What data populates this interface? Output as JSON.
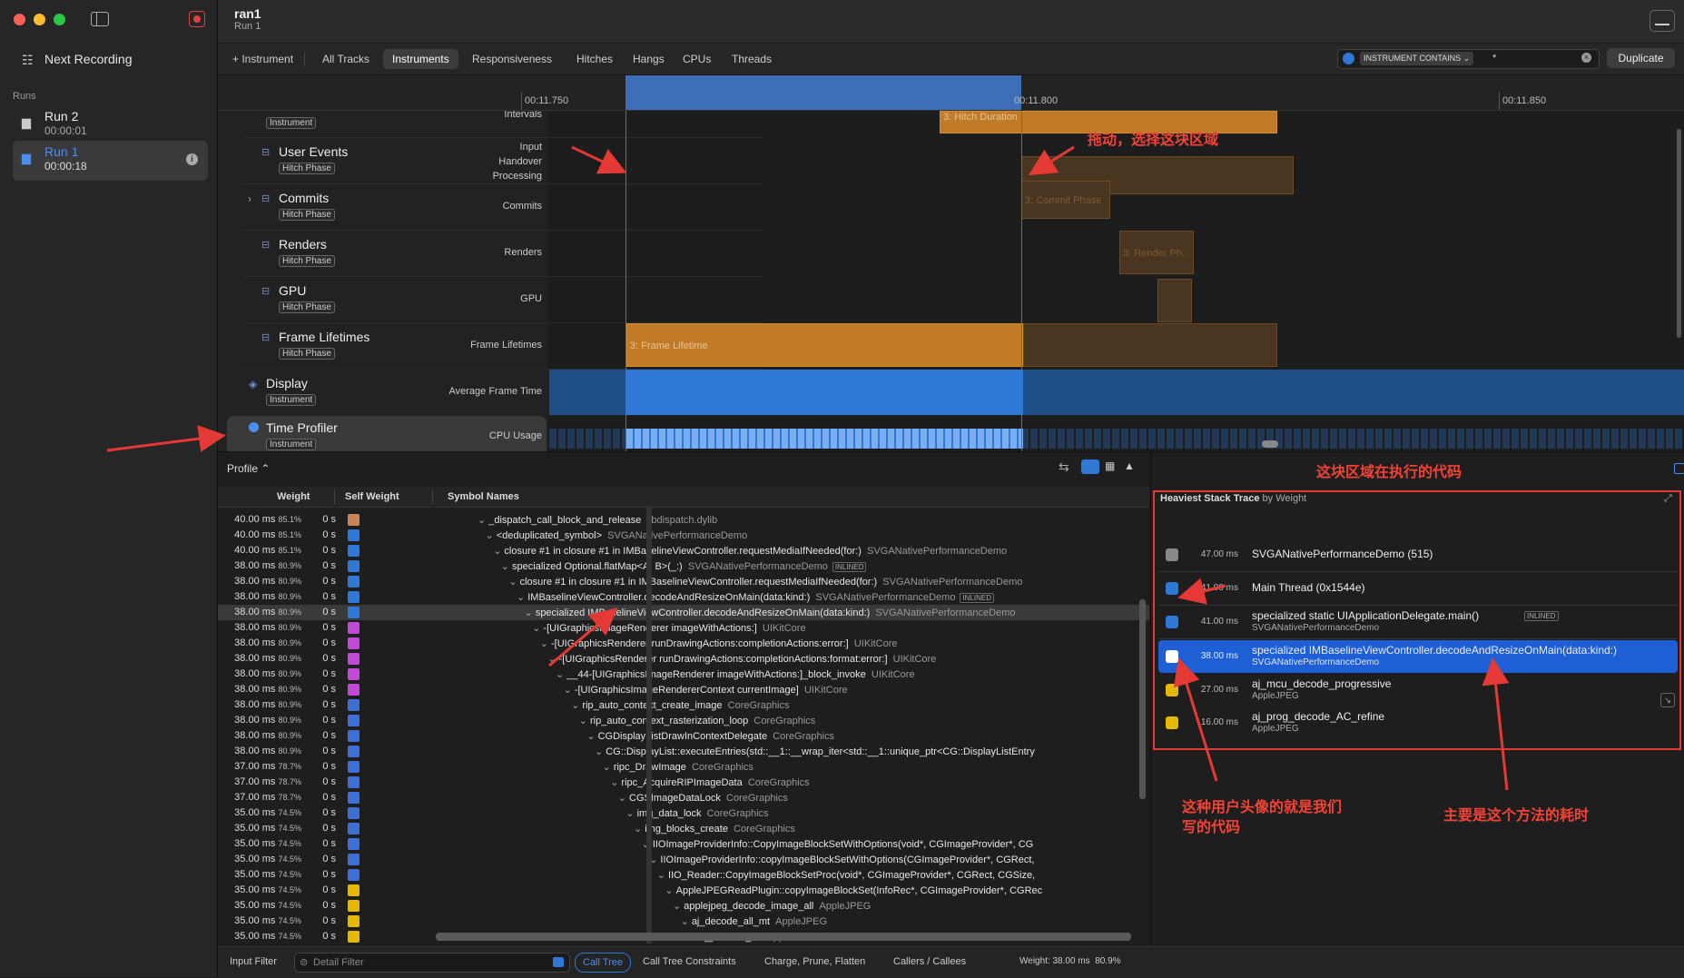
{
  "window": {
    "title": "ran1",
    "subtitle": "Run 1"
  },
  "sidebar": {
    "next_recording": "Next Recording",
    "runs_header": "Runs",
    "runs": [
      {
        "name": "Run 2",
        "time": "00:00:01"
      },
      {
        "name": "Run 1",
        "time": "00:00:18"
      }
    ]
  },
  "toolbar": {
    "add_instrument": "+ Instrument",
    "tabs": [
      "All Tracks",
      "Instruments",
      "Responsiveness",
      "Hitches",
      "Hangs",
      "CPUs",
      "Threads"
    ],
    "selected_tab": "Instruments",
    "filter_token": "INSTRUMENT CONTAINS ⌄",
    "filter_value": "*",
    "duplicate": "Duplicate"
  },
  "ruler": {
    "ticks": [
      "00:11.750",
      "00:11.800",
      "00:11.850"
    ]
  },
  "tracks": [
    {
      "name": "",
      "badge": "Instrument",
      "right": "Intervals"
    },
    {
      "name": "User Events",
      "badge": "Hitch Phase",
      "right": "Input\nHandover\nProcessing"
    },
    {
      "name": "Commits",
      "badge": "Hitch Phase",
      "right": "Commits"
    },
    {
      "name": "Renders",
      "badge": "Hitch Phase",
      "right": "Renders"
    },
    {
      "name": "GPU",
      "badge": "Hitch Phase",
      "right": "GPU"
    },
    {
      "name": "Frame Lifetimes",
      "badge": "Hitch Phase",
      "right": "Frame Lifetimes"
    },
    {
      "name": "Display",
      "badge": "Instrument",
      "right": "Average Frame Time"
    },
    {
      "name": "Time Profiler",
      "badge": "Instrument",
      "right": "CPU Usage"
    }
  ],
  "bars": {
    "hitch_duration": "3: Hitch Duration",
    "commit_phase": "3: Commit Phase",
    "render_phase": "3: Render Ph...",
    "frame_lifetime": "3: Frame Lifetime"
  },
  "calltree": {
    "profile_label": "Profile ⌃",
    "headers": {
      "weight": "Weight",
      "self_weight": "Self Weight",
      "symbol": "Symbol Names"
    },
    "rows": [
      {
        "w": "40.00 ms",
        "p": "85.1%",
        "s": "0 s",
        "icon": "dylib",
        "indent": 0,
        "sym": "_dispatch_call_block_and_release",
        "lib": "libdispatch.dylib"
      },
      {
        "w": "40.00 ms",
        "p": "85.1%",
        "s": "0 s",
        "icon": "user",
        "indent": 1,
        "sym": "<deduplicated_symbol>",
        "lib": "SVGANativePerformanceDemo"
      },
      {
        "w": "40.00 ms",
        "p": "85.1%",
        "s": "0 s",
        "icon": "user",
        "indent": 2,
        "sym": "closure #1 in closure #1 in IMBaselineViewController.requestMediaIfNeeded(for:)",
        "lib": "SVGANativePerformanceDemo"
      },
      {
        "w": "38.00 ms",
        "p": "80.9%",
        "s": "0 s",
        "icon": "user",
        "indent": 3,
        "sym": "specialized Optional.flatMap<A, B>(_:)",
        "lib": "SVGANativePerformanceDemo",
        "inlined": "INLINED"
      },
      {
        "w": "38.00 ms",
        "p": "80.9%",
        "s": "0 s",
        "icon": "user",
        "indent": 4,
        "sym": "closure #1 in closure #1 in IMBaselineViewController.requestMediaIfNeeded(for:)",
        "lib": "SVGANativePerformanceDemo"
      },
      {
        "w": "38.00 ms",
        "p": "80.9%",
        "s": "0 s",
        "icon": "user",
        "indent": 5,
        "sym": "IMBaselineViewController.decodeAndResizeOnMain(data:kind:)",
        "lib": "SVGANativePerformanceDemo",
        "inlined": "INLINED"
      },
      {
        "w": "38.00 ms",
        "p": "80.9%",
        "s": "0 s",
        "icon": "user",
        "indent": 6,
        "sym": "specialized IMBaselineViewController.decodeAndResizeOnMain(data:kind:)",
        "lib": "SVGANativePerformanceDemo",
        "selected": true
      },
      {
        "w": "38.00 ms",
        "p": "80.9%",
        "s": "0 s",
        "icon": "uikit",
        "indent": 7,
        "sym": "-[UIGraphicsImageRenderer imageWithActions:]",
        "lib": "UIKitCore"
      },
      {
        "w": "38.00 ms",
        "p": "80.9%",
        "s": "0 s",
        "icon": "uikit",
        "indent": 8,
        "sym": "-[UIGraphicsRenderer runDrawingActions:completionActions:error:]",
        "lib": "UIKitCore"
      },
      {
        "w": "38.00 ms",
        "p": "80.9%",
        "s": "0 s",
        "icon": "uikit",
        "indent": 9,
        "sym": "-[UIGraphicsRenderer runDrawingActions:completionActions:format:error:]",
        "lib": "UIKitCore"
      },
      {
        "w": "38.00 ms",
        "p": "80.9%",
        "s": "0 s",
        "icon": "uikit",
        "indent": 10,
        "sym": "__44-[UIGraphicsImageRenderer imageWithActions:]_block_invoke",
        "lib": "UIKitCore"
      },
      {
        "w": "38.00 ms",
        "p": "80.9%",
        "s": "0 s",
        "icon": "uikit",
        "indent": 11,
        "sym": "-[UIGraphicsImageRendererContext currentImage]",
        "lib": "UIKitCore"
      },
      {
        "w": "38.00 ms",
        "p": "80.9%",
        "s": "0 s",
        "icon": "cg",
        "indent": 12,
        "sym": "rip_auto_context_create_image",
        "lib": "CoreGraphics"
      },
      {
        "w": "38.00 ms",
        "p": "80.9%",
        "s": "0 s",
        "icon": "cg",
        "indent": 13,
        "sym": "rip_auto_context_rasterization_loop",
        "lib": "CoreGraphics"
      },
      {
        "w": "38.00 ms",
        "p": "80.9%",
        "s": "0 s",
        "icon": "cg",
        "indent": 14,
        "sym": "CGDisplayListDrawInContextDelegate",
        "lib": "CoreGraphics"
      },
      {
        "w": "38.00 ms",
        "p": "80.9%",
        "s": "0 s",
        "icon": "cg",
        "indent": 15,
        "sym": "CG::DisplayList::executeEntries(std::__1::__wrap_iter<std::__1::unique_ptr<CG::DisplayListEntry",
        "lib": ""
      },
      {
        "w": "37.00 ms",
        "p": "78.7%",
        "s": "0 s",
        "icon": "cg",
        "indent": 16,
        "sym": "ripc_DrawImage",
        "lib": "CoreGraphics"
      },
      {
        "w": "37.00 ms",
        "p": "78.7%",
        "s": "0 s",
        "icon": "cg",
        "indent": 17,
        "sym": "ripc_AcquireRIPImageData",
        "lib": "CoreGraphics"
      },
      {
        "w": "37.00 ms",
        "p": "78.7%",
        "s": "0 s",
        "icon": "cg",
        "indent": 18,
        "sym": "CGSImageDataLock",
        "lib": "CoreGraphics"
      },
      {
        "w": "35.00 ms",
        "p": "74.5%",
        "s": "0 s",
        "icon": "cg",
        "indent": 19,
        "sym": "img_data_lock",
        "lib": "CoreGraphics"
      },
      {
        "w": "35.00 ms",
        "p": "74.5%",
        "s": "0 s",
        "icon": "cg",
        "indent": 20,
        "sym": "img_blocks_create",
        "lib": "CoreGraphics"
      },
      {
        "w": "35.00 ms",
        "p": "74.5%",
        "s": "0 s",
        "icon": "cg",
        "indent": 21,
        "sym": "IIOImageProviderInfo::CopyImageBlockSetWithOptions(void*, CGImageProvider*, CG",
        "lib": ""
      },
      {
        "w": "35.00 ms",
        "p": "74.5%",
        "s": "0 s",
        "icon": "cg",
        "indent": 22,
        "sym": "IIOImageProviderInfo::copyImageBlockSetWithOptions(CGImageProvider*, CGRect,",
        "lib": ""
      },
      {
        "w": "35.00 ms",
        "p": "74.5%",
        "s": "0 s",
        "icon": "cg",
        "indent": 23,
        "sym": "IIO_Reader::CopyImageBlockSetProc(void*, CGImageProvider*, CGRect, CGSize,",
        "lib": ""
      },
      {
        "w": "35.00 ms",
        "p": "74.5%",
        "s": "0 s",
        "icon": "jpeg",
        "indent": 24,
        "sym": "AppleJPEGReadPlugin::copyImageBlockSet(InfoRec*, CGImageProvider*, CGRec",
        "lib": ""
      },
      {
        "w": "35.00 ms",
        "p": "74.5%",
        "s": "0 s",
        "icon": "jpeg",
        "indent": 25,
        "sym": "applejpeg_decode_image_all",
        "lib": "AppleJPEG"
      },
      {
        "w": "35.00 ms",
        "p": "74.5%",
        "s": "0 s",
        "icon": "jpeg",
        "indent": 26,
        "sym": "aj_decode_all_mt",
        "lib": "AppleJPEG"
      },
      {
        "w": "35.00 ms",
        "p": "74.5%",
        "s": "0 s",
        "icon": "jpeg",
        "indent": 27,
        "sym": "aj_decode_all",
        "lib": "AppleJPEG"
      }
    ]
  },
  "heaviest": {
    "title": "Heaviest Stack Trace",
    "subtitle": "by Weight",
    "rows": [
      {
        "ms": "47.00 ms",
        "name": "SVGANativePerformanceDemo (515)",
        "lib": "",
        "icon": "process"
      },
      {
        "ms": "41.00 ms",
        "name": "Main Thread (0x1544e)",
        "lib": "",
        "icon": "thread"
      },
      {
        "ms": "41.00 ms",
        "name": "specialized static UIApplicationDelegate.main()",
        "lib": "SVGANativePerformanceDemo",
        "icon": "user",
        "inlined": "INLINED"
      },
      {
        "ms": "38.00 ms",
        "name": "specialized IMBaselineViewController.decodeAndResizeOnMain(data:kind:)",
        "lib": "SVGANativePerformanceDemo",
        "icon": "user",
        "selected": true
      },
      {
        "ms": "27.00 ms",
        "name": "aj_mcu_decode_progressive",
        "lib": "AppleJPEG",
        "icon": "jpeg"
      },
      {
        "ms": "16.00 ms",
        "name": "aj_prog_decode_AC_refine",
        "lib": "AppleJPEG",
        "icon": "jpeg"
      }
    ]
  },
  "statusbar": {
    "input_filter": "Input Filter",
    "detail_filter_placeholder": "Detail Filter",
    "call_tree": "Call Tree",
    "constraints": "Call Tree Constraints",
    "charge": "Charge, Prune, Flatten",
    "callers": "Callers / Callees",
    "weight": "Weight: 38.00 ms  80.9%"
  },
  "annotations": {
    "drag": "拖动，选择这块区域",
    "region_code": "这块区域在执行的代码",
    "user_avatar_1": "这种用户头像的就是我们",
    "user_avatar_2": "写的代码",
    "main_cost": "主要是这个方法的耗时"
  },
  "colors": {
    "accent": "#1e5fd6",
    "bar": "#c07a28",
    "annotation": "#e53935",
    "selection": "#2f78d6"
  }
}
